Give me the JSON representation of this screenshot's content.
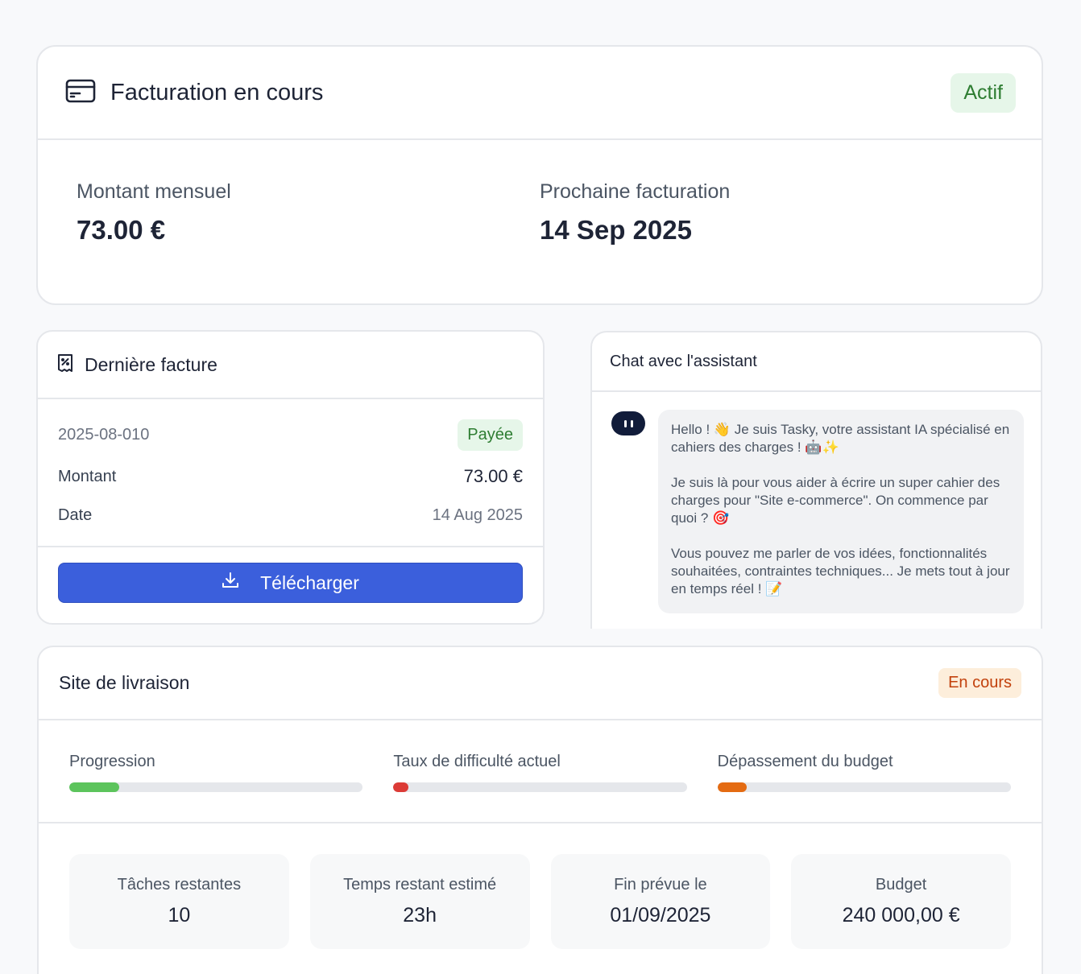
{
  "billing": {
    "title": "Facturation en cours",
    "status": "Actif",
    "monthly_label": "Montant mensuel",
    "monthly_value": "73.00 €",
    "next_label": "Prochaine facturation",
    "next_value": "14 Sep 2025"
  },
  "invoice": {
    "title": "Dernière facture",
    "number": "2025-08-010",
    "status": "Payée",
    "amount_label": "Montant",
    "amount_value": "73.00 €",
    "date_label": "Date",
    "date_value": "14 Aug 2025",
    "download_label": "Télécharger"
  },
  "chat": {
    "title": "Chat avec l'assistant",
    "message": {
      "p1": "Hello ! 👋 Je suis Tasky, votre assistant IA spécialisé en cahiers des charges ! 🤖✨",
      "p2": "Je suis là pour vous aider à écrire un super cahier des charges pour \"Site e-commerce\". On commence par quoi ? 🎯",
      "p3": "Vous pouvez me parler de vos idées, fonctionnalités souhaitées, contraintes techniques... Je mets tout à jour en temps réel ! 📝"
    }
  },
  "delivery": {
    "title": "Site de livraison",
    "status": "En cours",
    "metrics": [
      {
        "label": "Progression",
        "fraction": 0.17,
        "color": "#5cc45c"
      },
      {
        "label": "Taux de difficulté actuel",
        "fraction": 0.05,
        "color": "#dc3b36"
      },
      {
        "label": "Dépassement du budget",
        "fraction": 0.1,
        "color": "#e46b12"
      }
    ],
    "stats": [
      {
        "label": "Tâches restantes",
        "value": "10"
      },
      {
        "label": "Temps restant estimé",
        "value": "23h"
      },
      {
        "label": "Fin prévue le",
        "value": "01/09/2025"
      },
      {
        "label": "Budget",
        "value": "240 000,00 €"
      }
    ]
  }
}
